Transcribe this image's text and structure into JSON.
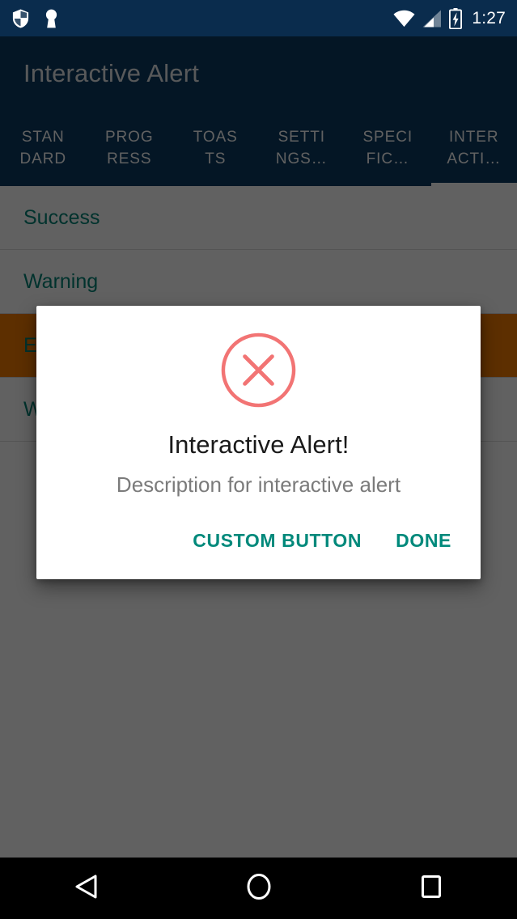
{
  "status_bar": {
    "time": "1:27",
    "icons": [
      "shield-icon",
      "keyhole-icon",
      "wifi-icon",
      "cell-signal-icon",
      "battery-charging-icon"
    ],
    "background_color": "#0a2c4d"
  },
  "toolbar": {
    "title": "Interactive Alert",
    "background_color": "#0d3c62",
    "tabs": [
      {
        "line1": "STAN",
        "line2": "DARD",
        "full": "STANDARD",
        "active": false
      },
      {
        "line1": "PROG",
        "line2": "RESS",
        "full": "PROGRESS",
        "active": false
      },
      {
        "line1": "TOAS",
        "line2": "TS",
        "full": "TOASTS",
        "active": false
      },
      {
        "line1": "SETTI",
        "line2": "NGS…",
        "full": "SETTINGS…",
        "active": false
      },
      {
        "line1": "SPECI",
        "line2": "FIC…",
        "full": "SPECIFIC…",
        "active": false
      },
      {
        "line1": "INTER",
        "line2": "ACTI…",
        "full": "INTERACTI…",
        "active": true
      }
    ]
  },
  "list": {
    "accent_color": "#008577",
    "ripple_color": "#f57c00",
    "items": [
      {
        "label": "Success",
        "pressed": false
      },
      {
        "label": "Warning",
        "pressed": false
      },
      {
        "label": "Error",
        "pressed": true
      },
      {
        "label": "Warning",
        "pressed": false
      }
    ]
  },
  "dialog": {
    "icon": "error-circle-x-icon",
    "icon_color": "#f27474",
    "title": "Interactive Alert!",
    "description": "Description for interactive alert",
    "buttons": [
      {
        "label": "CUSTOM BUTTON"
      },
      {
        "label": "DONE"
      }
    ],
    "button_color": "#00897b"
  },
  "nav_bar": {
    "buttons": [
      {
        "name": "back-button"
      },
      {
        "name": "home-button"
      },
      {
        "name": "recents-button"
      }
    ],
    "background_color": "#000000"
  }
}
